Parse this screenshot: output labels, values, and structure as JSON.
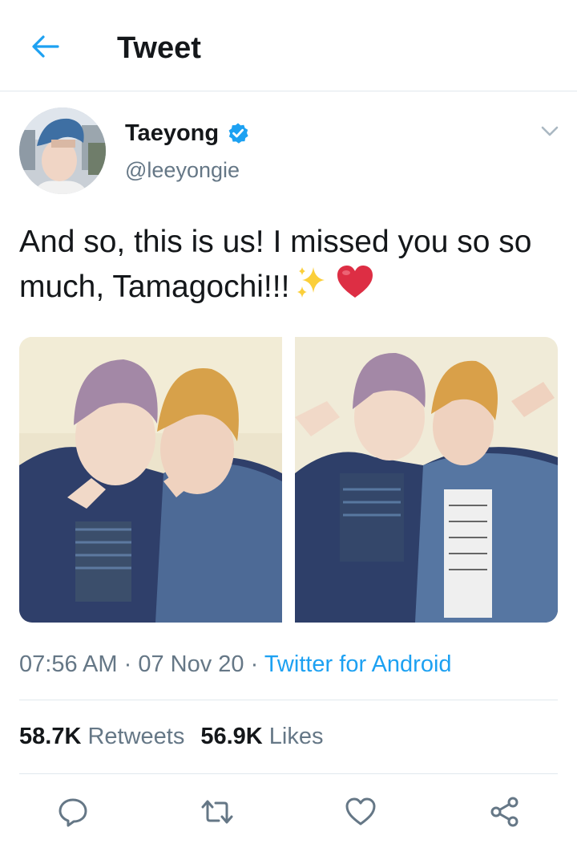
{
  "header": {
    "title": "Tweet",
    "back_icon": "arrow-left-icon"
  },
  "author": {
    "name": "Taeyong",
    "handle": "@leeyongie",
    "verified": true
  },
  "tweet": {
    "text": "And so, this is us! I missed you so so much, Tamagochi!!!",
    "emojis": [
      "sparkles-emoji",
      "red-heart-emoji"
    ],
    "photo_count": 2
  },
  "meta": {
    "time": "07:56 AM",
    "separator": "·",
    "date": "07 Nov 20",
    "source": "Twitter for Android"
  },
  "stats": {
    "retweets_count": "58.7K",
    "retweets_label": "Retweets",
    "likes_count": "56.9K",
    "likes_label": "Likes"
  },
  "actions": [
    "reply-icon",
    "retweet-icon",
    "like-icon",
    "share-icon"
  ],
  "colors": {
    "accent": "#1da1f2",
    "text": "#14171a",
    "secondary": "#657786",
    "divider": "#e1e8ed"
  }
}
